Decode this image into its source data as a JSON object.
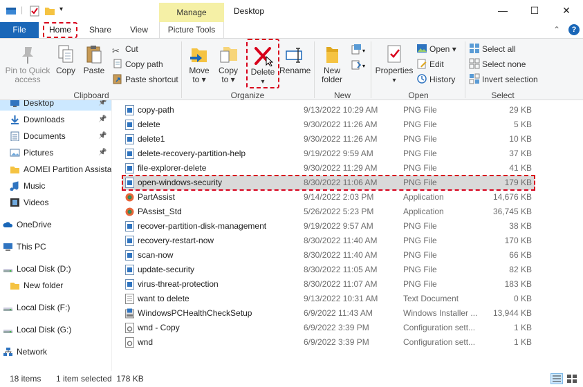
{
  "window": {
    "title": "Desktop",
    "contextual_group": "Manage",
    "minimize": "—",
    "maximize": "☐",
    "close": "✕"
  },
  "tabs": {
    "file": "File",
    "home": "Home",
    "share": "Share",
    "view": "View",
    "picture_tools": "Picture Tools",
    "toggle": "⌃",
    "help": "?"
  },
  "ribbon": {
    "clipboard": {
      "label": "Clipboard",
      "pin": "Pin to Quick access",
      "pin_l1": "Pin to Quick",
      "pin_l2": "access",
      "copy": "Copy",
      "paste": "Paste",
      "cut": "Cut",
      "copy_path": "Copy path",
      "paste_shortcut": "Paste shortcut"
    },
    "organize": {
      "label": "Organize",
      "move_to_l1": "Move",
      "move_to_l2": "to ▾",
      "copy_to_l1": "Copy",
      "copy_to_l2": "to ▾",
      "delete": "Delete",
      "delete_arrow": "▾",
      "rename": "Rename"
    },
    "new": {
      "label": "New",
      "new_folder_l1": "New",
      "new_folder_l2": "folder"
    },
    "open": {
      "label": "Open",
      "properties": "Properties",
      "properties_arrow": "▾",
      "open": "Open ▾",
      "edit": "Edit",
      "history": "History"
    },
    "select": {
      "label": "Select",
      "select_all": "Select all",
      "select_none": "Select none",
      "invert": "Invert selection"
    }
  },
  "nav": {
    "items": [
      {
        "label": "Desktop",
        "pinned": "📌"
      },
      {
        "label": "Downloads",
        "pinned": "📌"
      },
      {
        "label": "Documents",
        "pinned": "📌"
      },
      {
        "label": "Pictures",
        "pinned": "📌"
      },
      {
        "label": "AOMEI Partition Assistant"
      },
      {
        "label": "Music"
      },
      {
        "label": "Videos"
      },
      {
        "label": "OneDrive"
      },
      {
        "label": "This PC"
      },
      {
        "label": "Local Disk (D:)"
      },
      {
        "label": "New folder"
      },
      {
        "label": "Local Disk (F:)"
      },
      {
        "label": "Local Disk (G:)"
      },
      {
        "label": "Network"
      }
    ]
  },
  "files": [
    {
      "name": "copy-path",
      "date": "9/13/2022 10:29 AM",
      "type": "PNG File",
      "size": "29 KB",
      "icon": "image"
    },
    {
      "name": "delete",
      "date": "9/30/2022 11:26 AM",
      "type": "PNG File",
      "size": "5 KB",
      "icon": "image"
    },
    {
      "name": "delete1",
      "date": "9/30/2022 11:26 AM",
      "type": "PNG File",
      "size": "10 KB",
      "icon": "image"
    },
    {
      "name": "delete-recovery-partition-help",
      "date": "9/19/2022 9:59 AM",
      "type": "PNG File",
      "size": "37 KB",
      "icon": "image"
    },
    {
      "name": "file-explorer-delete",
      "date": "9/30/2022 11:29 AM",
      "type": "PNG File",
      "size": "41 KB",
      "icon": "image"
    },
    {
      "name": "open-windows-security",
      "date": "8/30/2022 11:06 AM",
      "type": "PNG File",
      "size": "179 KB",
      "icon": "image"
    },
    {
      "name": "PartAssist",
      "date": "9/14/2022 2:03 PM",
      "type": "Application",
      "size": "14,676 KB",
      "icon": "app"
    },
    {
      "name": "PAssist_Std",
      "date": "5/26/2022 5:23 PM",
      "type": "Application",
      "size": "36,745 KB",
      "icon": "app"
    },
    {
      "name": "recover-partition-disk-management",
      "date": "9/19/2022 9:57 AM",
      "type": "PNG File",
      "size": "38 KB",
      "icon": "image"
    },
    {
      "name": "recovery-restart-now",
      "date": "8/30/2022 11:40 AM",
      "type": "PNG File",
      "size": "170 KB",
      "icon": "image"
    },
    {
      "name": "scan-now",
      "date": "8/30/2022 11:40 AM",
      "type": "PNG File",
      "size": "66 KB",
      "icon": "image"
    },
    {
      "name": "update-security",
      "date": "8/30/2022 11:05 AM",
      "type": "PNG File",
      "size": "82 KB",
      "icon": "image"
    },
    {
      "name": "virus-threat-protection",
      "date": "8/30/2022 11:07 AM",
      "type": "PNG File",
      "size": "183 KB",
      "icon": "image"
    },
    {
      "name": "want to delete",
      "date": "9/13/2022 10:31 AM",
      "type": "Text Document",
      "size": "0 KB",
      "icon": "text"
    },
    {
      "name": "WindowsPCHealthCheckSetup",
      "date": "6/9/2022 11:43 AM",
      "type": "Windows Installer ...",
      "size": "13,944 KB",
      "icon": "installer"
    },
    {
      "name": "wnd - Copy",
      "date": "6/9/2022 3:39 PM",
      "type": "Configuration sett...",
      "size": "1 KB",
      "icon": "config"
    },
    {
      "name": "wnd",
      "date": "6/9/2022 3:39 PM",
      "type": "Configuration sett...",
      "size": "1 KB",
      "icon": "config"
    }
  ],
  "selected_index": 5,
  "status": {
    "count": "18 items",
    "selection": "1 item selected  178 KB"
  },
  "colors": {
    "accent": "#1a67b8",
    "highlight": "#d8001b",
    "contextual": "#f5f0a6"
  }
}
